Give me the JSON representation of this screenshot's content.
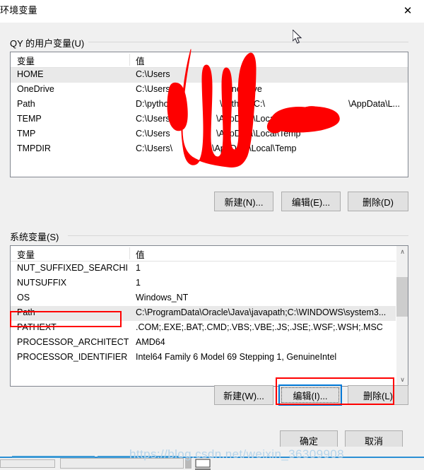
{
  "window": {
    "title": "环境变量",
    "close_label": "✕"
  },
  "user_section": {
    "label": "QY 的用户变量(U)",
    "columns": [
      "变量",
      "值"
    ],
    "rows": [
      {
        "name": "HOME",
        "value": "C:\\Users",
        "selected": true
      },
      {
        "name": "OneDrive",
        "value": "C:\\Users",
        "value2": "OneDrive",
        "selected": false
      },
      {
        "name": "Path",
        "value": "D:\\python",
        "value2": "\\python\\;C:\\",
        "value3": "\\AppData\\L...",
        "selected": false
      },
      {
        "name": "TEMP",
        "value": "C:\\Users",
        "value2": "\\AppData\\Local\\Temp",
        "selected": false
      },
      {
        "name": "TMP",
        "value": "C:\\Users",
        "value2": "\\AppData\\Local\\Temp",
        "selected": false
      },
      {
        "name": "TMPDIR",
        "value": "C:\\Users\\",
        "value2": "\\AppData\\Local\\Temp",
        "selected": false
      }
    ],
    "buttons": {
      "new": "新建(N)...",
      "edit": "编辑(E)...",
      "delete": "删除(D)"
    }
  },
  "system_section": {
    "label": "系统变量(S)",
    "columns": [
      "变量",
      "值"
    ],
    "rows": [
      {
        "name": "NUT_SUFFIXED_SEARCHI",
        "value": "1",
        "selected": false
      },
      {
        "name": "NUTSUFFIX",
        "value": "1",
        "selected": false
      },
      {
        "name": "OS",
        "value": "Windows_NT",
        "selected": false
      },
      {
        "name": "Path",
        "value": "C:\\ProgramData\\Oracle\\Java\\javapath;C:\\WINDOWS\\system3...",
        "selected": true
      },
      {
        "name": "PATHEXT",
        "value": ".COM;.EXE;.BAT;.CMD;.VBS;.VBE;.JS;.JSE;.WSF;.WSH;.MSC",
        "selected": false
      },
      {
        "name": "PROCESSOR_ARCHITECT",
        "value": "AMD64",
        "selected": false
      },
      {
        "name": "PROCESSOR_IDENTIFIER",
        "value": "Intel64 Family 6 Model 69 Stepping 1, GenuineIntel",
        "selected": false
      }
    ],
    "buttons": {
      "new": "新建(W)...",
      "edit": "编辑(I)...",
      "delete": "删除(L)"
    },
    "scroll": {
      "up_glyph": "∧",
      "down_glyph": "∨"
    }
  },
  "dialog_buttons": {
    "ok": "确定",
    "cancel": "取消"
  },
  "watermark": {
    "text": "https://blog.csdn.net/weixin_36309908"
  },
  "colors": {
    "dialog_bg": "#f0f0f0",
    "list_bg": "#ffffff",
    "list_border": "#828790",
    "selection": "#e9e9e9",
    "button_face": "#e1e1e1",
    "button_border": "#adadad",
    "focus_blue": "#0078d7",
    "annotation_red": "#ff0000",
    "watermark_blue": "#b6d4ea",
    "taskbar_blue": "#2b8fd4"
  }
}
